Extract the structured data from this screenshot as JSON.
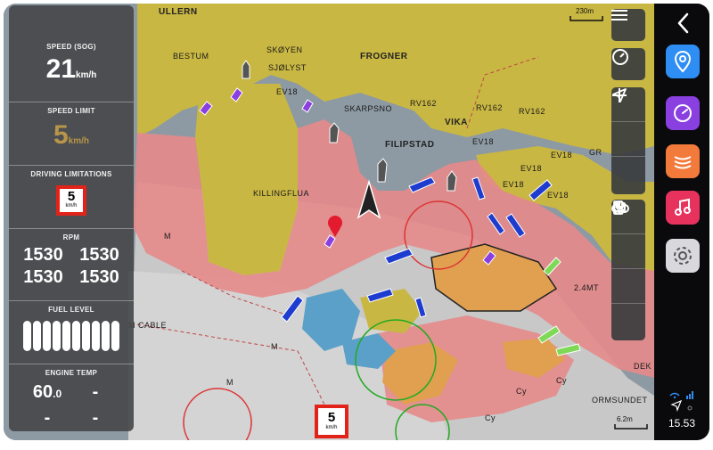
{
  "map": {
    "place_labels": [
      "ULLERN",
      "BESTUM",
      "SKØYEN",
      "SJØLYST",
      "FROGNER",
      "SKARPSNO",
      "VIKA",
      "FILIPSTAD",
      "KILLINGFLUA",
      "GR",
      "DEK",
      "ORMSUNDET"
    ],
    "route_labels": [
      "EV18",
      "RV162",
      "EV18",
      "RV162",
      "EV18",
      "EV18",
      "RV162",
      "EV18",
      "EV18"
    ],
    "misc_labels": [
      "M CABLE",
      "2.4MT",
      "Cy",
      "Cy",
      "Cy",
      "M",
      "M",
      "M"
    ],
    "scale_top": "230m",
    "scale_bottom": "6.2m",
    "road_sign": {
      "value": "5",
      "unit": "km/h"
    }
  },
  "info_panel": {
    "speed": {
      "title": "SPEED (SOG)",
      "value": "21",
      "unit": "km/h"
    },
    "speed_limit": {
      "title": "SPEED LIMIT",
      "value": "5",
      "unit": "km/h"
    },
    "driving_limitations": {
      "title": "DRIVING LIMITATIONS",
      "sign_value": "5",
      "sign_unit": "km/h"
    },
    "rpm": {
      "title": "RPM",
      "values": [
        "1530",
        "1530",
        "1530",
        "1530"
      ]
    },
    "fuel": {
      "title": "FUEL LEVEL",
      "bars": 10
    },
    "engine_temp": {
      "title": "ENGINE TEMP",
      "value_main": "60",
      "value_decimal": ".0",
      "placeholders": [
        "-",
        "-",
        "-"
      ]
    }
  },
  "toolbar": {
    "icons": [
      "menu-icon",
      "gauge-icon",
      "zoom-in-icon",
      "zoom-out-icon",
      "navigation-arrow-icon",
      "binoculars-icon",
      "hand-icon",
      "fuel-icon",
      "add-location-icon"
    ]
  },
  "apps": {
    "items": [
      {
        "name": "maps",
        "color": "#2f8ef4"
      },
      {
        "name": "speed",
        "color": "#8a3fe0"
      },
      {
        "name": "sonar",
        "color": "#f27a3a"
      },
      {
        "name": "music",
        "color": "#e8325e"
      },
      {
        "name": "settings",
        "color": "#d9d9dd"
      }
    ],
    "clock": "15.53"
  },
  "colors": {
    "panel_bg": "#46484a",
    "limit_gold": "#b9954a",
    "sign_red": "#e2231a"
  }
}
